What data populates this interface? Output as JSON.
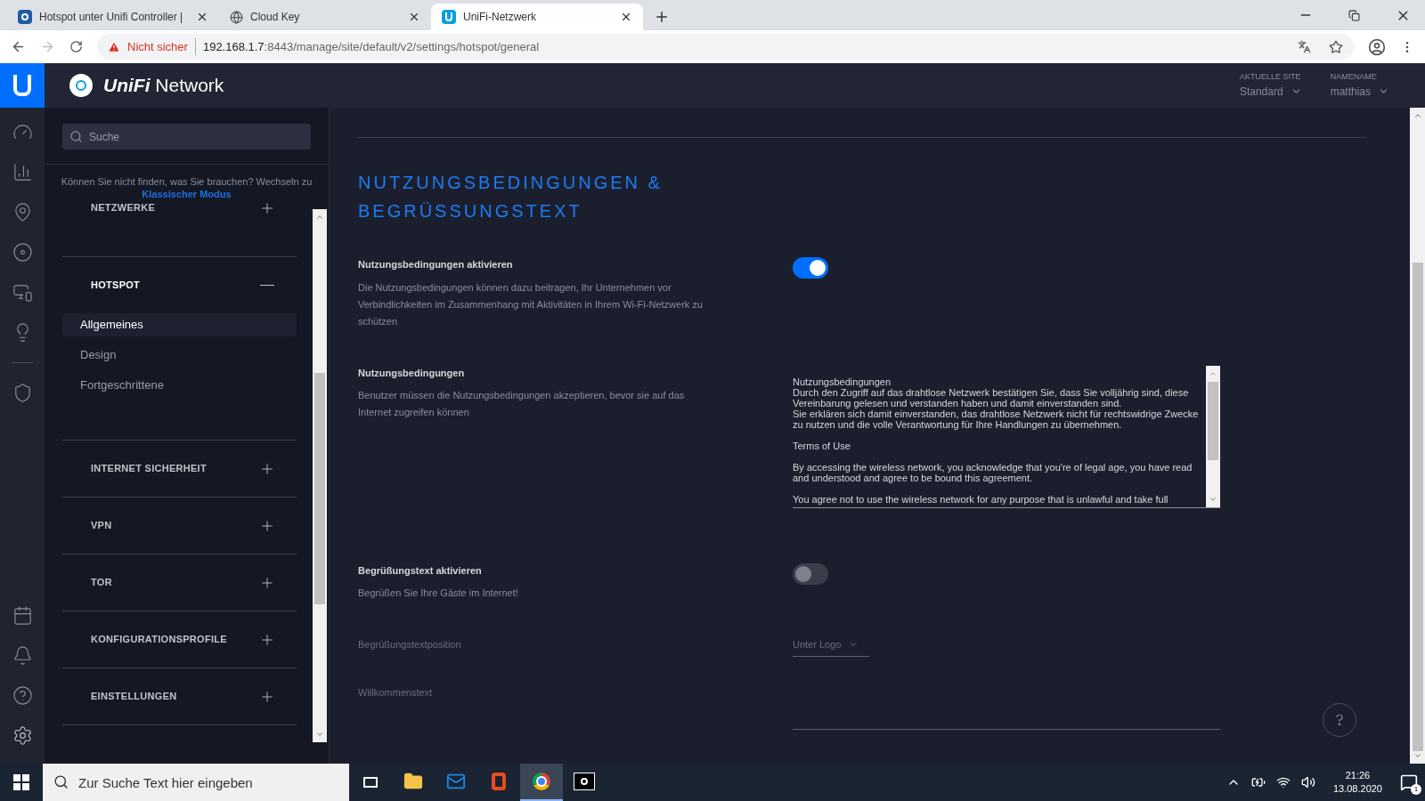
{
  "browser": {
    "tabs": [
      {
        "title": "Hotspot unter Unifi Controller |",
        "selected": false
      },
      {
        "title": "Cloud Key",
        "selected": false
      },
      {
        "title": "UniFi-Netzwerk",
        "selected": true
      }
    ],
    "address": {
      "warning": "Nicht sicher",
      "host": "192.168.1.7",
      "path": ":8443/manage/site/default/v2/settings/hotspot/general"
    }
  },
  "header": {
    "brand": "UniFi",
    "product": "Network",
    "site_label": "AKTUELLE SITE",
    "site_value": "Standard",
    "user_label": "NAMENAME",
    "user_value": "matthias"
  },
  "sidebar": {
    "search": {
      "placeholder": "Suche"
    },
    "hint": "Können Sie nicht finden, was Sie brauchen? Wechseln zu",
    "hint_link": "Klassischer Modus",
    "sections": [
      {
        "label": "NETZWERKE",
        "expanded": false
      },
      {
        "label": "HOTSPOT",
        "expanded": true,
        "items": [
          {
            "label": "Allgemeines",
            "selected": true
          },
          {
            "label": "Design",
            "selected": false
          },
          {
            "label": "Fortgeschrittene",
            "selected": false
          }
        ]
      },
      {
        "label": "INTERNET SICHERHEIT",
        "expanded": false
      },
      {
        "label": "VPN",
        "expanded": false
      },
      {
        "label": "TOR",
        "expanded": false
      },
      {
        "label": "KONFIGURATIONSPROFILE",
        "expanded": false
      },
      {
        "label": "EINSTELLUNGEN",
        "expanded": false
      }
    ]
  },
  "main": {
    "title": "NUTZUNGSBEDINGUNGEN & BEGRÜSSUNGSTEXT",
    "settings": [
      {
        "kind": "toggle",
        "label": "Nutzungsbedingungen aktivieren",
        "description": "Die Nutzungsbedingungen können dazu beitragen, Ihr Unternehmen vor Verbindlichkeiten im Zusammenhang mit Aktivitäten in Ihrem Wi-Fi-Netzwerk zu schützen",
        "on": true
      },
      {
        "kind": "textarea",
        "label": "Nutzungsbedingungen",
        "description": "Benutzer müssen die Nutzungsbedingungen akzeptieren, bevor sie auf das Internet zugreifen können",
        "paragraphs": [
          "Nutzungsbedingungen\nDurch den Zugriff auf das drahtlose Netzwerk bestätigen Sie, dass Sie volljährig sind, diese Vereinbarung gelesen und verstanden haben und damit einverstanden sind.\nSie erklären sich damit einverstanden, das drahtlose Netzwerk nicht für rechtswidrige Zwecke zu nutzen und die volle Verantwortung für Ihre Handlungen zu übernehmen.",
          "Terms of Use",
          "By accessing the wireless network, you acknowledge that you're of legal age, you have read and understood and agree to be bound this agreement.",
          "You agree not to use the wireless network for any purpose that is unlawful and take full"
        ]
      },
      {
        "kind": "toggle",
        "label": "Begrüßungstext aktivieren",
        "description": "Begrüßen Sie Ihre Gäste im Internet!",
        "on": false
      },
      {
        "kind": "select",
        "label": "Begrüßungstextposition",
        "value": "Unter Logo",
        "disabled": true
      },
      {
        "kind": "textfield",
        "label": "Willkommenstext",
        "disabled": true
      }
    ]
  },
  "taskbar": {
    "search": {
      "placeholder": "Zur Suche Text hier eingeben"
    },
    "apps": [
      {
        "kind": "explorer",
        "selected": false
      },
      {
        "kind": "mail",
        "selected": false
      },
      {
        "kind": "office",
        "selected": false
      },
      {
        "kind": "chrome",
        "selected": true
      },
      {
        "kind": "qfi",
        "selected": false
      }
    ],
    "time": "21:26",
    "date": "13.08.2020",
    "notifications": "1"
  }
}
